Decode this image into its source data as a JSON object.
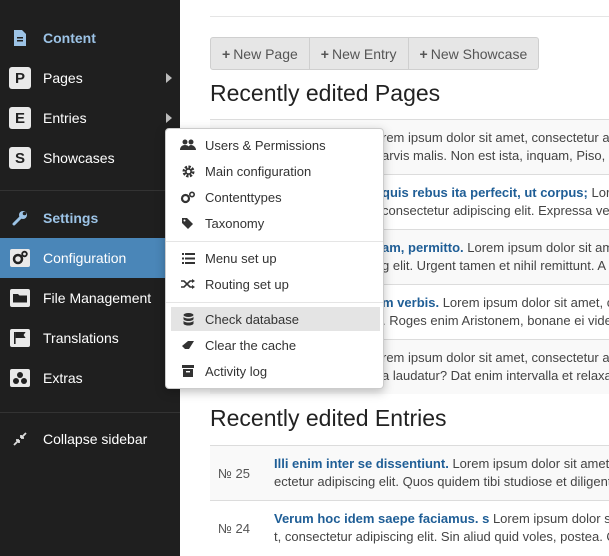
{
  "sidebar": {
    "content_header": "Content",
    "items": {
      "pages": {
        "label": "Pages",
        "letter": "P"
      },
      "entries": {
        "label": "Entries",
        "letter": "E"
      },
      "showcases": {
        "label": "Showcases",
        "letter": "S"
      }
    },
    "settings_header": "Settings",
    "configuration": "Configuration",
    "file_management": "File Management",
    "translations": "Translations",
    "extras": "Extras",
    "collapse": "Collapse sidebar"
  },
  "toolbar": {
    "new_page": "New Page",
    "new_entry": "New Entry",
    "new_showcase": "New Showcase"
  },
  "pages_section": {
    "heading": "Recently edited Pages",
    "rows": [
      {
        "title": "",
        "line1": "rem ipsum dolor sit amet, consectetur ad",
        "line2": "arvis malis. Non est ista, inquam, Piso, m"
      },
      {
        "title": "quis rebus ita perfecit, ut corpus;",
        "line1": " Lor",
        "line2": "consectetur adipiscing elit. Expressa ve"
      },
      {
        "title": "am, permitto.",
        "line1": " Lorem ipsum dolor sit amet",
        "line2": "g elit. Urgent tamen et nihil remittunt. A"
      },
      {
        "title": "m verbis.",
        "line1": " Lorem ipsum dolor sit amet, co",
        "line2": ". Roges enim Aristonem, bonane ei vide"
      },
      {
        "title": "",
        "line1": "rem ipsum dolor sit amet, consectetur ad",
        "line2": "a laudatur? Dat enim intervalla et relaxa"
      }
    ]
  },
  "entries_section": {
    "heading": "Recently edited Entries",
    "rows": [
      {
        "num": "№ 25",
        "title": "Illi enim inter se dissentiunt.",
        "line1": " Lorem ipsum dolor sit amet,",
        "line2": "ectetur adipiscing elit. Quos quidem tibi studiose et diligente"
      },
      {
        "num": "№ 24",
        "title": "Verum hoc idem saepe faciamus. s",
        "line1": " Lorem ipsum dolor sit",
        "line2": "t, consectetur adipiscing elit. Sin aliud quid voles, postea. Q"
      }
    ]
  },
  "dropdown": {
    "users": "Users & Permissions",
    "main_config": "Main configuration",
    "contenttypes": "Contenttypes",
    "taxonomy": "Taxonomy",
    "menu": "Menu set up",
    "routing": "Routing set up",
    "check_db": "Check database",
    "clear_cache": "Clear the cache",
    "activity_log": "Activity log"
  },
  "colors": {
    "sidebar_bg": "#1f1f1f",
    "active_item": "#4a86b8",
    "header_text": "#9cc3e6",
    "link": "#1f5e96"
  }
}
